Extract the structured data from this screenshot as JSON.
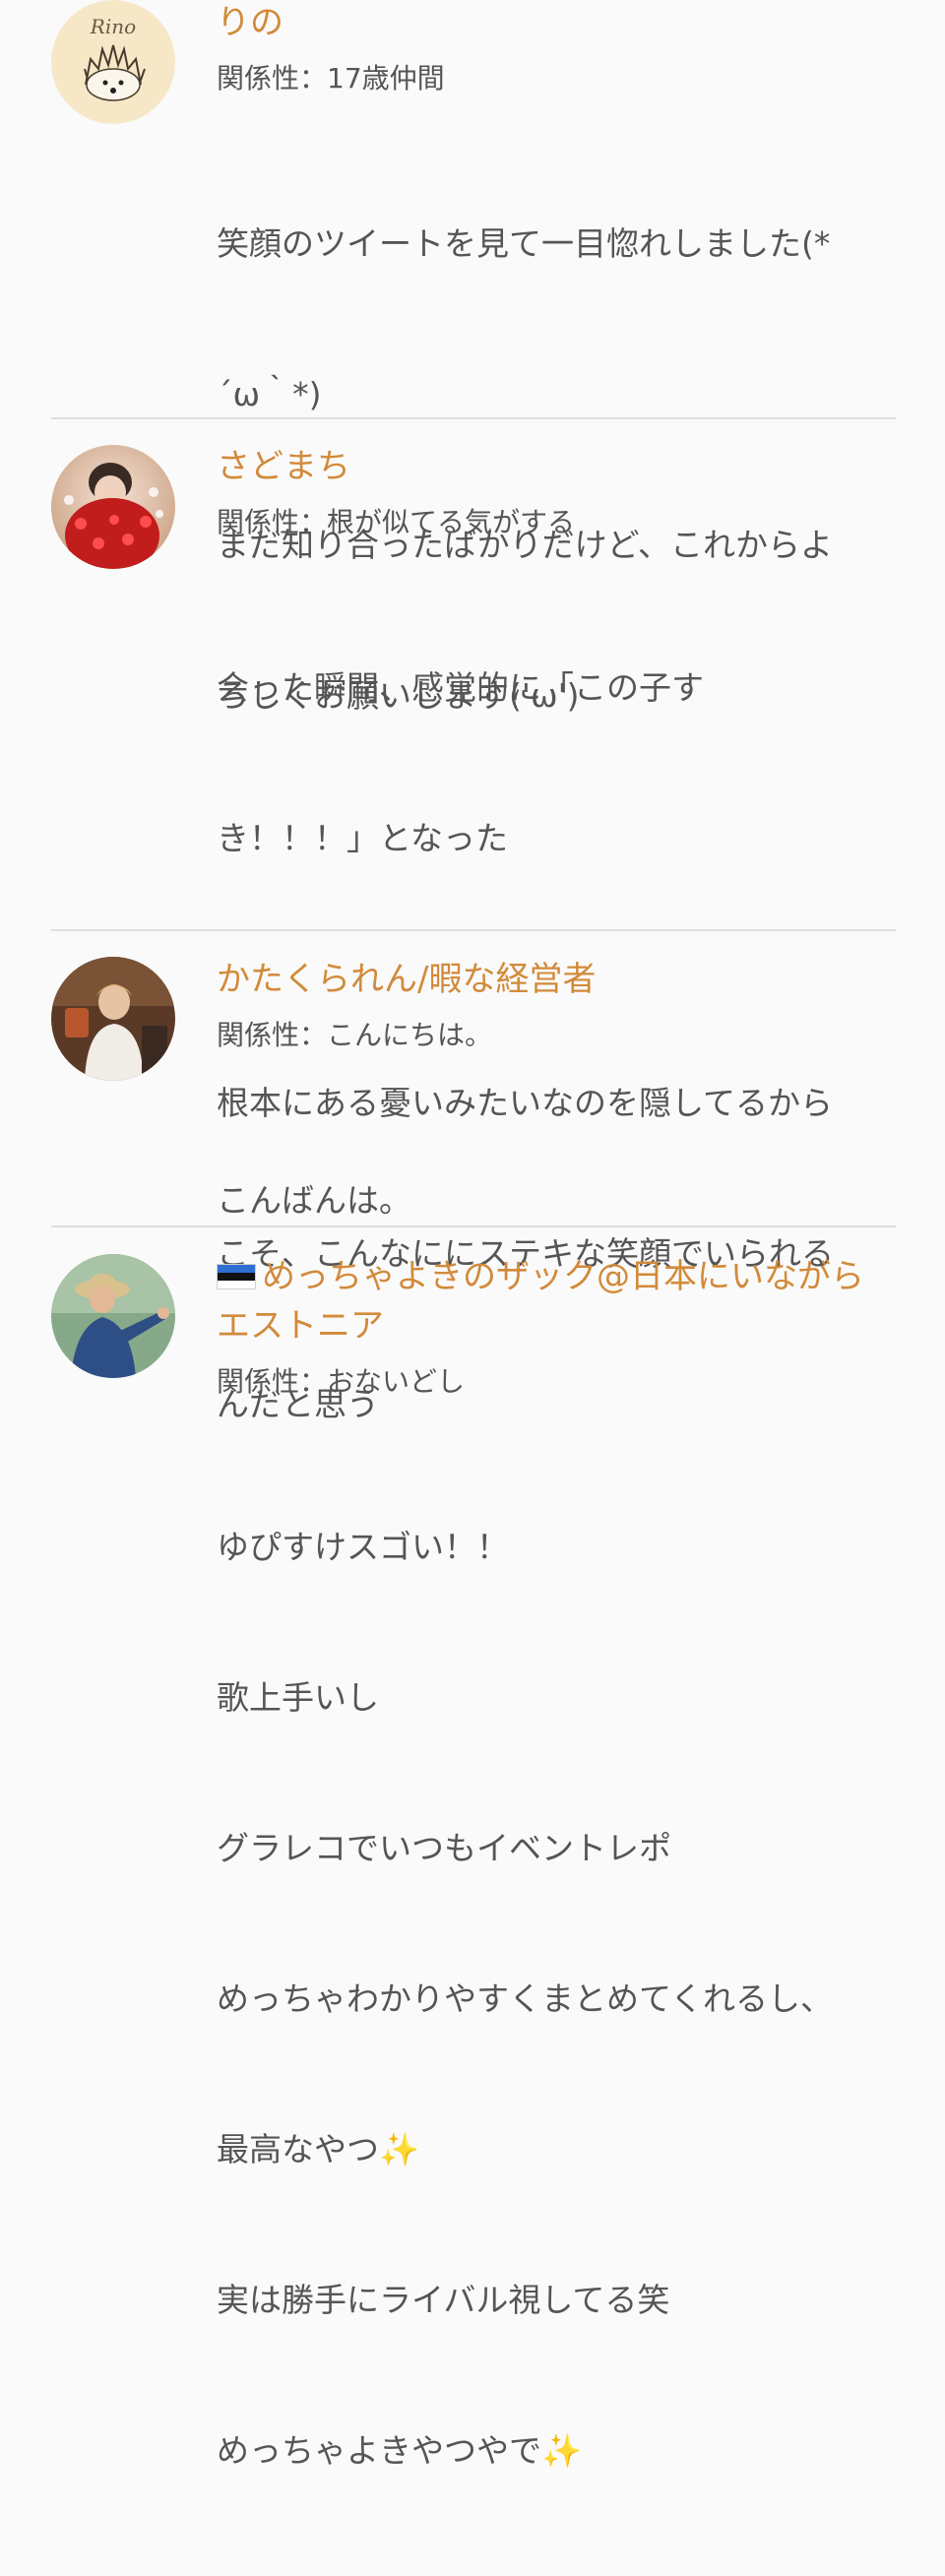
{
  "entries": [
    {
      "name": "りの",
      "relation": "関係性：17歳仲間",
      "message_lines": [
        "笑顔のツイートを見て一目惚れしました(*",
        "´ω｀*)",
        "まだ知り合ったばかりだけど、これからよ",
        "ろしくお願いします('ω')"
      ],
      "avatar": {
        "kind": "hedgehog-logo",
        "text": "Rino",
        "bg": "#f6e7c7"
      }
    },
    {
      "name": "さどまち",
      "relation": "関係性：根が似てる気がする",
      "message_blocks": [
        [
          "会った瞬間、感覚的に「この子す",
          "き！！！」となった"
        ],
        [
          "根本にある憂いみたいなのを隠してるから",
          "こそ、こんなににステキな笑顔でいられる",
          "んだと思う"
        ]
      ],
      "avatar": {
        "kind": "photo-red-flowers"
      }
    },
    {
      "name": "かたくられん/暇な経営者",
      "relation": "関係性：こんにちは。",
      "message_lines": [
        "こんばんは。"
      ],
      "avatar": {
        "kind": "photo-person-indoors"
      }
    },
    {
      "name": "めっちゃよきのザック@日本にいながら",
      "name_line2": "エストニア",
      "flag_icon": "estonia-flag-icon",
      "relation": "関係性：おないどし",
      "message_lines": [
        "ゆぴすけスゴい！！",
        "歌上手いし",
        "グラレコでいつもイベントレポ",
        "めっちゃわかりやすくまとめてくれるし、",
        "最高なやつ✨",
        "実は勝手にライバル視してる笑",
        "めっちゃよきやつやで✨"
      ],
      "avatar": {
        "kind": "photo-person-outdoors"
      }
    }
  ],
  "colors": {
    "name": "#d28a3a",
    "text": "#555555",
    "divider": "#dedede",
    "background": "#fafafa"
  }
}
